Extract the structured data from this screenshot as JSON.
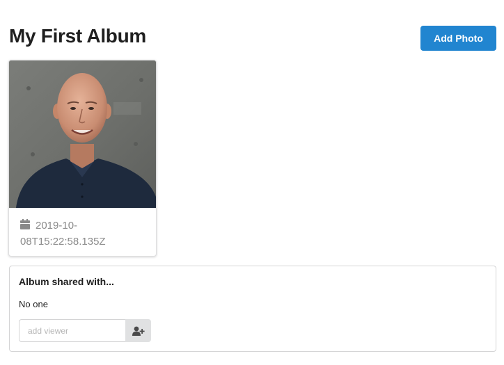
{
  "album": {
    "title": "My First Album",
    "add_photo_label": "Add Photo"
  },
  "photos": [
    {
      "date_icon": "calendar-icon",
      "date": "2019-10-08T15:22:58.135Z"
    }
  ],
  "sharing": {
    "heading": "Album shared with...",
    "status": "No one",
    "viewer_placeholder": "add viewer",
    "add_viewer_icon": "add-user-icon"
  },
  "colors": {
    "primary": "#2185d0",
    "muted_text": "#8a8a8a",
    "button_grey": "#e0e1e2"
  }
}
